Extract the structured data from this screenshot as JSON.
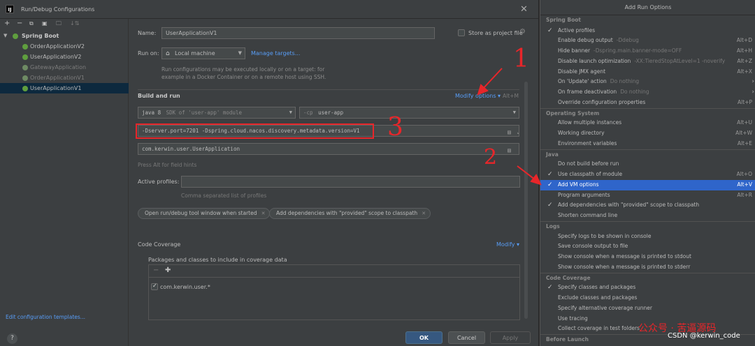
{
  "dialog": {
    "title": "Run/Debug Configurations",
    "app_icon": "IJ",
    "close": "✕"
  },
  "toolbar": {
    "add": "+",
    "remove": "−",
    "copy": "⧉",
    "folder": "🗀",
    "sort": "↓⇅"
  },
  "tree": {
    "root": "Spring Boot",
    "items": [
      "OrderApplicationV2",
      "UserApplicationV2",
      "GatewayApplication",
      "OrderApplicationV1",
      "UserApplicationV1"
    ]
  },
  "edit_templates": "Edit configuration templates...",
  "form": {
    "name_label": "Name:",
    "name_value": "UserApplicationV1",
    "store_label": "Store as project file",
    "run_on_label": "Run on:",
    "run_on_value": "Local machine",
    "manage_targets": "Manage targets...",
    "run_on_hint": "Run configurations may be executed locally or on a target: for example in a Docker Container or on a remote host using SSH.",
    "build_and_run": "Build and run",
    "modify_options": "Modify options",
    "modify_shortcut": "Alt+M",
    "jdk_value": "java 8",
    "jdk_suffix": "SDK of 'user-app' module",
    "cp_prefix": "-cp",
    "cp_value": "user-app",
    "vm_options": "-Dserver.port=7201 -Dspring.cloud.nacos.discovery.metadata.version=V1",
    "main_class": "com.kerwin.user.UserApplication",
    "field_hint": "Press Alt for field hints",
    "active_profiles_label": "Active profiles:",
    "active_profiles_hint": "Comma separated list of profiles",
    "chip1": "Open run/debug tool window when started",
    "chip2": "Add dependencies with \"provided\" scope to classpath",
    "code_coverage": "Code Coverage",
    "modify": "Modify",
    "coverage_label": "Packages and classes to include in coverage data",
    "coverage_item": "com.kerwin.user.*"
  },
  "buttons": {
    "help": "?",
    "ok": "OK",
    "cancel": "Cancel",
    "apply": "Apply"
  },
  "annotations": {
    "n1": "1",
    "n2": "2",
    "n3": "3"
  },
  "popup": {
    "title": "Add Run Options",
    "groups": [
      {
        "name": "Spring Boot",
        "items": [
          {
            "checked": true,
            "name": "Active profiles",
            "desc": "",
            "shortcut": ""
          },
          {
            "checked": false,
            "name": "Enable debug output",
            "desc": "-Ddebug",
            "shortcut": "Alt+D"
          },
          {
            "checked": false,
            "name": "Hide banner",
            "desc": "-Dspring.main.banner-mode=OFF",
            "shortcut": "Alt+H"
          },
          {
            "checked": false,
            "name": "Disable launch optimization",
            "desc": "-XX:TieredStopAtLevel=1 -noverify",
            "shortcut": "Alt+Z"
          },
          {
            "checked": false,
            "name": "Disable JMX agent",
            "desc": "",
            "shortcut": "Alt+X"
          },
          {
            "checked": false,
            "name": "On 'Update' action",
            "desc": "Do nothing",
            "shortcut": "",
            "submenu": true
          },
          {
            "checked": false,
            "name": "On frame deactivation",
            "desc": "Do nothing",
            "shortcut": "",
            "submenu": true
          },
          {
            "checked": false,
            "name": "Override configuration properties",
            "desc": "",
            "shortcut": "Alt+P"
          }
        ]
      },
      {
        "name": "Operating System",
        "items": [
          {
            "checked": false,
            "name": "Allow multiple instances",
            "desc": "",
            "shortcut": "Alt+U"
          },
          {
            "checked": false,
            "name": "Working directory",
            "desc": "",
            "shortcut": "Alt+W"
          },
          {
            "checked": false,
            "name": "Environment variables",
            "desc": "",
            "shortcut": "Alt+E"
          }
        ]
      },
      {
        "name": "Java",
        "items": [
          {
            "checked": false,
            "name": "Do not build before run",
            "desc": "",
            "shortcut": ""
          },
          {
            "checked": true,
            "name": "Use classpath of module",
            "desc": "",
            "shortcut": "Alt+O"
          },
          {
            "checked": true,
            "name": "Add VM options",
            "desc": "",
            "shortcut": "Alt+V",
            "selected": true
          },
          {
            "checked": false,
            "name": "Program arguments",
            "desc": "",
            "shortcut": "Alt+R"
          },
          {
            "checked": true,
            "name": "Add dependencies with \"provided\" scope to classpath",
            "desc": "",
            "shortcut": ""
          },
          {
            "checked": false,
            "name": "Shorten command line",
            "desc": "",
            "shortcut": ""
          }
        ]
      },
      {
        "name": "Logs",
        "items": [
          {
            "checked": false,
            "name": "Specify logs to be shown in console",
            "desc": "",
            "shortcut": ""
          },
          {
            "checked": false,
            "name": "Save console output to file",
            "desc": "",
            "shortcut": ""
          },
          {
            "checked": false,
            "name": "Show console when a message is printed to stdout",
            "desc": "",
            "shortcut": ""
          },
          {
            "checked": false,
            "name": "Show console when a message is printed to stderr",
            "desc": "",
            "shortcut": ""
          }
        ]
      },
      {
        "name": "Code Coverage",
        "items": [
          {
            "checked": true,
            "name": "Specify classes and packages",
            "desc": "",
            "shortcut": ""
          },
          {
            "checked": false,
            "name": "Exclude classes and packages",
            "desc": "",
            "shortcut": ""
          },
          {
            "checked": false,
            "name": "Specify alternative coverage runner",
            "desc": "",
            "shortcut": ""
          },
          {
            "checked": false,
            "name": "Use tracing",
            "desc": "",
            "shortcut": ""
          },
          {
            "checked": false,
            "name": "Collect coverage in test folders",
            "desc": "",
            "shortcut": ""
          }
        ]
      },
      {
        "name": "Before Launch",
        "items": []
      }
    ]
  },
  "watermark": {
    "cn": "公众号 · 苦逼源码",
    "csdn": "CSDN @kerwin_code"
  },
  "colors": {
    "accent": "#2f65ca",
    "link": "#589df6",
    "annotation": "#e8262a",
    "ok": "#365880"
  }
}
